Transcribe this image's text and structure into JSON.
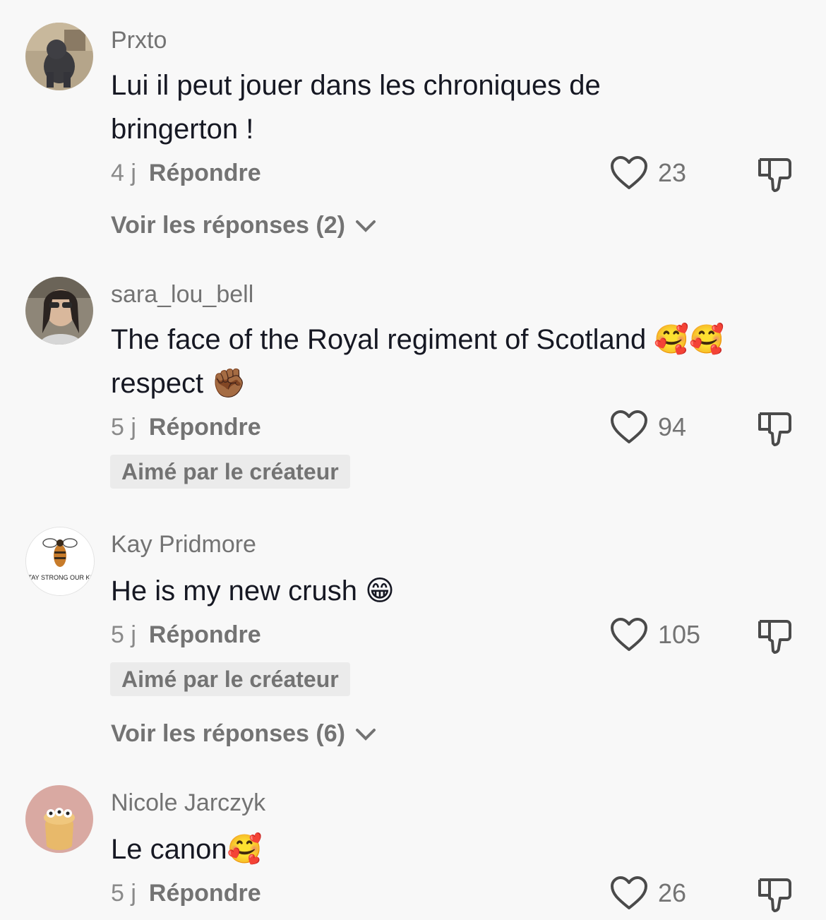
{
  "comments": [
    {
      "username": "Prxto",
      "text": "Lui il peut jouer dans les chroniques de bringerton !",
      "age": "4 j",
      "reply_label": "Répondre",
      "likes": "23",
      "view_replies": "Voir les réponses (2)"
    },
    {
      "username": "sara_lou_bell",
      "text": "The face of the Royal regiment of Scotland 🥰🥰 respect ✊🏾",
      "age": "5 j",
      "reply_label": "Répondre",
      "likes": "94",
      "badge": "Aimé par le créateur"
    },
    {
      "username": "Kay Pridmore",
      "text": "He is my new crush 😁",
      "age": "5 j",
      "reply_label": "Répondre",
      "likes": "105",
      "badge": "Aimé par le créateur",
      "view_replies": "Voir les réponses (6)",
      "avatar_text": "STAY STRONG OUR KID"
    },
    {
      "username": "Nicole Jarczyk",
      "text": "Le canon🥰",
      "age": "5 j",
      "reply_label": "Répondre",
      "likes": "26"
    }
  ],
  "colors": {
    "background": "#f8f8f8",
    "text": "#161823",
    "secondary": "#737373",
    "badge_bg": "#ebebeb"
  }
}
